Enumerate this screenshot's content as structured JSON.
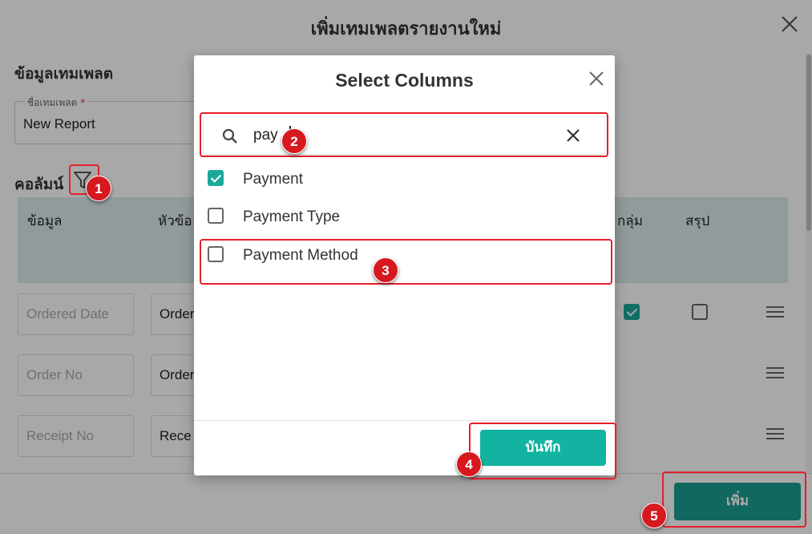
{
  "outer_dialog": {
    "title": "เพิ่มเทมเพลตรายงานใหม่",
    "section_title": "ข้อมูลเทมเพลต",
    "name_field": {
      "label": "ชื่อเทมเพลต",
      "required_mark": "*",
      "value": "New Report"
    },
    "columns_title": "คอลัมน์",
    "table_headers": [
      "ข้อมูล",
      "หัวข้อ",
      "กลุ่ม",
      "สรุป"
    ],
    "rows": [
      {
        "field": "Ordered Date",
        "header": "Order",
        "group_checked": true,
        "summary_checked": false
      },
      {
        "field": "Order No",
        "header": "Order"
      },
      {
        "field": "Receipt No",
        "header": "Rece"
      }
    ],
    "add_button": "เพิ่ม"
  },
  "modal": {
    "title": "Select Columns",
    "search_value": "pay",
    "options": [
      {
        "label": "Payment",
        "checked": true
      },
      {
        "label": "Payment Type",
        "checked": false
      },
      {
        "label": "Payment Method",
        "checked": false
      }
    ],
    "save_button": "บันทึก"
  },
  "annotations": [
    "1",
    "2",
    "3",
    "4",
    "5"
  ],
  "colors": {
    "accent": "#12b3a0",
    "highlight": "#e5202a",
    "table_header_bg": "#dcecec"
  }
}
